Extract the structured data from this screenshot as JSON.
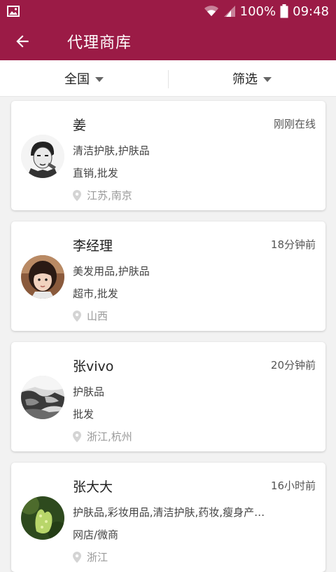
{
  "status_bar": {
    "battery": "100%",
    "time": "09:48",
    "icons": [
      "image-notification-icon",
      "wifi-icon",
      "signal-icon",
      "battery-icon"
    ]
  },
  "app_bar": {
    "title": "代理商库",
    "back_icon": "arrow-left-icon",
    "color": "#9b1b46"
  },
  "filters": {
    "region": "全国",
    "filter": "筛选"
  },
  "agents": [
    {
      "name": "姜",
      "time": "刚刚在线",
      "categories": "清洁护肤,护肤品",
      "channel": "直销,批发",
      "location": "江苏,南京"
    },
    {
      "name": "李经理",
      "time": "18分钟前",
      "categories": "美发用品,护肤品",
      "channel": "超市,批发",
      "location": "山西"
    },
    {
      "name": "张vivo",
      "time": "20分钟前",
      "categories": "护肤品",
      "channel": "批发",
      "location": "浙江,杭州"
    },
    {
      "name": "张大大",
      "time": "16小时前",
      "categories": "护肤品,彩妆用品,清洁护肤,药妆,瘦身产…",
      "channel": "网店/微商",
      "location": "浙江"
    }
  ]
}
